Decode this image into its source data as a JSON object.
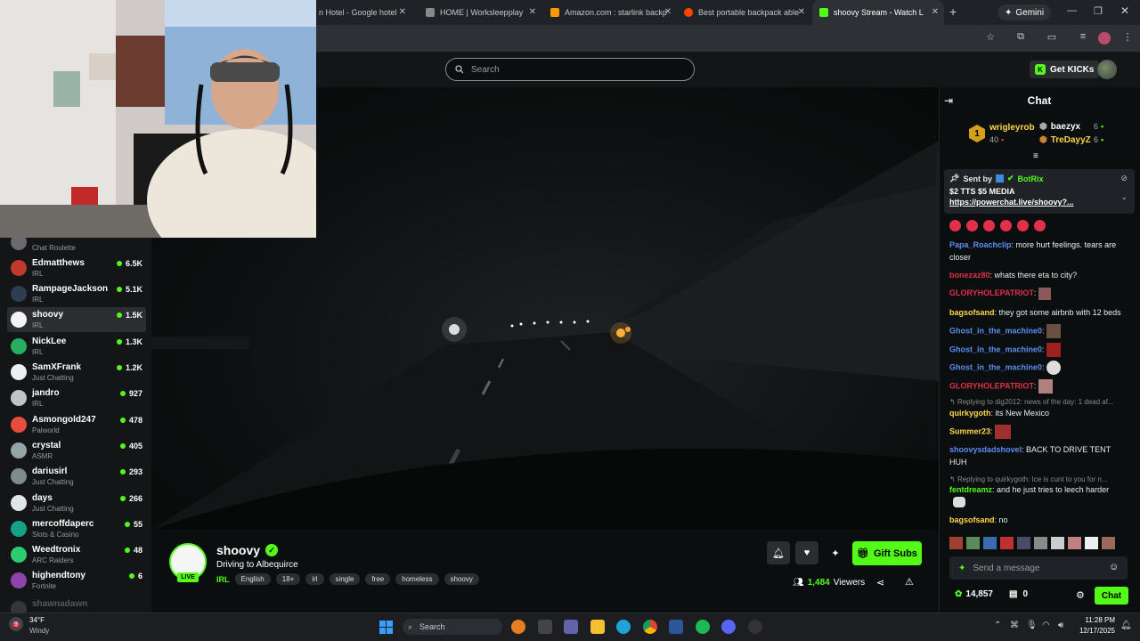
{
  "browser": {
    "tabs": [
      {
        "label": "n Hotel - Google hotel",
        "color": "#4285f4"
      },
      {
        "label": "HOME | Worksleepplay",
        "color": "#888888"
      },
      {
        "label": "Amazon.com : starlink backp",
        "color": "#ff9900"
      },
      {
        "label": "Best portable backpack able",
        "color": "#ff4500"
      },
      {
        "label": "shoovy Stream - Watch L",
        "color": "#53fc18"
      }
    ],
    "new_tab": "+",
    "gemini": "Gemini"
  },
  "search": {
    "placeholder": "Search"
  },
  "header": {
    "get_kicks": "Get KICKs"
  },
  "sidebar": {
    "items": [
      {
        "name": "",
        "category": "Chat Roulette",
        "viewers": "",
        "avatar": "#6a6a70"
      },
      {
        "name": "Edmatthews",
        "category": "IRL",
        "viewers": "6.5K",
        "avatar": "#c0392b"
      },
      {
        "name": "RampageJackson",
        "category": "IRL",
        "viewers": "5.1K",
        "avatar": "#2c3e50"
      },
      {
        "name": "shoovy",
        "category": "IRL",
        "viewers": "1.5K",
        "avatar": "#f4f4f4"
      },
      {
        "name": "NickLee",
        "category": "IRL",
        "viewers": "1.3K",
        "avatar": "#27ae60"
      },
      {
        "name": "SamXFrank",
        "category": "Just Chatting",
        "viewers": "1.2K",
        "avatar": "#ecf0f1"
      },
      {
        "name": "jandro",
        "category": "IRL",
        "viewers": "927",
        "avatar": "#bdc3c7"
      },
      {
        "name": "Asmongold247",
        "category": "Palworld",
        "viewers": "478",
        "avatar": "#e74c3c"
      },
      {
        "name": "crystal",
        "category": "ASMR",
        "viewers": "405",
        "avatar": "#95a5a6"
      },
      {
        "name": "dariusirl",
        "category": "Just Chatting",
        "viewers": "293",
        "avatar": "#7f8c8d"
      },
      {
        "name": "days",
        "category": "Just Chatting",
        "viewers": "266",
        "avatar": "#dfe6e9"
      },
      {
        "name": "mercoffdaperc",
        "category": "Slots & Casino",
        "viewers": "55",
        "avatar": "#16a085"
      },
      {
        "name": "Weedtronix",
        "category": "ARC Raiders",
        "viewers": "48",
        "avatar": "#2ecc71"
      },
      {
        "name": "highendtony",
        "category": "Fortnite",
        "viewers": "6",
        "avatar": "#8e44ad"
      },
      {
        "name": "shawnadawn",
        "category": "",
        "viewers": "",
        "avatar": "#555555"
      }
    ]
  },
  "stream": {
    "channel": "shoovy",
    "title": "Driving to Albequirce",
    "category": "IRL",
    "tags": [
      "English",
      "18+",
      "irl",
      "single",
      "free",
      "homeless",
      "shoovy"
    ],
    "live": "LIVE",
    "gift_subs": "Gift Subs",
    "viewers": "1,484",
    "viewers_label": "Viewers"
  },
  "chat": {
    "title": "Chat",
    "leaderboard": {
      "first": {
        "rank": "1",
        "name": "wrigleyrob",
        "count": "40"
      },
      "second": {
        "name": "baezyx",
        "count": "6"
      },
      "third": {
        "name": "TreDayyZ",
        "count": "6"
      }
    },
    "pinned": {
      "sent_by": "Sent by",
      "bot": "BotRix",
      "text": "$2 TTS $5 MEDIA",
      "link": "https://powerchat.live/shoovy?..."
    },
    "messages": [
      {
        "user": "Papa_Roachclip",
        "color": "#5b8def",
        "text": "more hurt feelings. tears are closer"
      },
      {
        "user": "bonezaz80",
        "color": "#e0304a",
        "text": "whats there eta to city?"
      },
      {
        "user": "GLORYHOLEPATRIOT",
        "color": "#e0304a",
        "text": ""
      },
      {
        "user": "bagsofsand",
        "color": "#ffd54a",
        "text": "they got some airbnb with 12 beds"
      },
      {
        "user": "Ghost_in_the_machine0",
        "color": "#5b8def",
        "text": ""
      },
      {
        "user": "Ghost_in_the_machine0",
        "color": "#5b8def",
        "text": ""
      },
      {
        "user": "Ghost_in_the_machine0",
        "color": "#5b8def",
        "text": ""
      },
      {
        "user": "GLORYHOLEPATRIOT",
        "color": "#e0304a",
        "text": ""
      },
      {
        "user": "quirkygoth",
        "color": "#ffd54a",
        "text": "its New Mexico",
        "reply": "Replying to dig2012: news of the day: 1 dead af..."
      },
      {
        "user": "Summer23",
        "color": "#ffd54a",
        "text": ""
      },
      {
        "user": "shoovysdadshovel",
        "color": "#5b8def",
        "text": "BACK TO DRIVE TENT HUH"
      },
      {
        "user": "fentdreamz",
        "color": "#53fc18",
        "text": "and he just tries to leech harder",
        "reply": "Replying to quirkygoth: Ice is cunt to you for n..."
      },
      {
        "user": "bagsofsand",
        "color": "#ffd54a",
        "text": "no"
      }
    ],
    "input_placeholder": "Send a message",
    "points": "14,857",
    "boxes": "0",
    "chat_button": "Chat"
  },
  "taskbar": {
    "weather_temp": "34°F",
    "weather_desc": "Windy",
    "weather_badge": "9",
    "search": "Search",
    "time": "11:28 PM",
    "date": "12/17/2025"
  }
}
